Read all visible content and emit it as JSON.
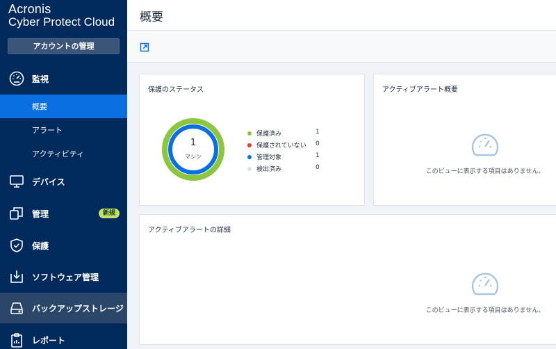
{
  "brand": {
    "line1": "Acronis",
    "line2": "Cyber Protect Cloud"
  },
  "sidebar": {
    "account_button": "アカウントの管理",
    "monitoring": {
      "label": "監視",
      "icon": "gauge-icon"
    },
    "sub_items": [
      {
        "label": "概要",
        "active": true
      },
      {
        "label": "アラート",
        "active": false
      },
      {
        "label": "アクティビティ",
        "active": false
      }
    ],
    "items": [
      {
        "label": "デバイス",
        "icon": "monitor-icon"
      },
      {
        "label": "管理",
        "icon": "copy-icon",
        "badge": "新規"
      },
      {
        "label": "保護",
        "icon": "shield-check-icon"
      },
      {
        "label": "ソフトウェア管理",
        "icon": "download-box-icon"
      },
      {
        "label": "バックアップストレージ",
        "icon": "storage-drive-icon"
      },
      {
        "label": "レポート",
        "icon": "report-icon"
      }
    ]
  },
  "header": {
    "title": "概要"
  },
  "toolbar": {
    "icon": "expand-icon"
  },
  "protection_status": {
    "title": "保護のステータス",
    "total": "1",
    "total_label": "マシン",
    "legend": [
      {
        "label": "保護済み",
        "value": "1",
        "color": "#8cc63f"
      },
      {
        "label": "保護されていない",
        "value": "0",
        "color": "#e53935"
      },
      {
        "label": "管理対象",
        "value": "1",
        "color": "#0a6fe0"
      },
      {
        "label": "検出済み",
        "value": "0",
        "color": "#dde3ea"
      }
    ]
  },
  "active_alerts_summary": {
    "title": "アクティブアラート概要",
    "empty_text": "このビューに表示する項目はありません。"
  },
  "active_alerts_details": {
    "title": "アクティブアラートの詳細",
    "empty_text": "このビューに表示する項目はありません。"
  }
}
